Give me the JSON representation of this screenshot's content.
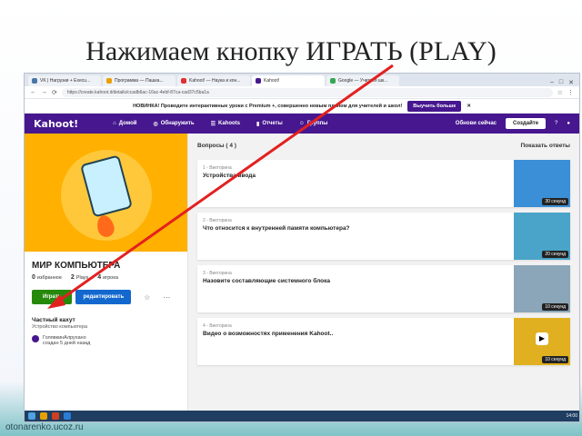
{
  "slide": {
    "title": "Нажимаем кнопку ИГРАТЬ (PLAY)",
    "watermark": "otonarenko.ucoz.ru"
  },
  "browser": {
    "tabs": [
      {
        "label": "VK | Нагрузки + Execu..."
      },
      {
        "label": "Программа — Пашка..."
      },
      {
        "label": "Kahoot! — Наука и кон..."
      },
      {
        "label": "Kahoot!"
      },
      {
        "label": "Google — Учиться шк..."
      }
    ],
    "url": "https://create.kahoot.it/details/ccadb6ac-16ac-4ebf-87ca-cad37c5ba1a",
    "promo_text": "НОВИНКА! Проводите интерактивные уроки с Premium +, совершенно новым планом для учителей и школ!",
    "promo_button": "Выучить больше",
    "promo_close": "✕"
  },
  "navbar": {
    "logo": "Kahoot!",
    "items": [
      "Домой",
      "Обнаружить",
      "Kahoots",
      "Отчеты",
      "Группы"
    ],
    "upgrade": "Обнови сейчас",
    "create": "Создайте"
  },
  "quiz": {
    "title": "МИР КОМПЬЮТЕРА",
    "stats": [
      {
        "num": "0",
        "label": "избранное"
      },
      {
        "num": "2",
        "label": "Plays"
      },
      {
        "num": "4",
        "label": "игрока"
      }
    ],
    "play_label": "Играть",
    "edit_label": "редактировать",
    "visibility": "Частный кахут",
    "description": "Устройство компьютера",
    "author_name": "ГолявкинАлрухано",
    "author_meta": "создан 5 дней назад"
  },
  "questions": {
    "header": "Вопросы  ( 4 )",
    "show_answers": "Показать ответы",
    "items": [
      {
        "type": "1 - Викторина",
        "title": "Устройства ввода",
        "time": "30 секунд",
        "color": "#3a8fd6"
      },
      {
        "type": "2 - Викторина",
        "title": "Что относится к внутренней памяти компьютера?",
        "time": "20 секунд",
        "color": "#4aa3c8"
      },
      {
        "type": "3 - Викторина",
        "title": "Назовите составляющие системного блока",
        "time": "10 секунд",
        "color": "#8aa6b8"
      },
      {
        "type": "4 - Викторина",
        "title": "Видео о возможностях применения Kahoot..",
        "time": "10 секунд",
        "color": "#e0b020"
      }
    ]
  },
  "taskbar": {
    "time": "14:00"
  },
  "colors": {
    "brand": "#46178f",
    "play": "#26890c",
    "edit": "#1368ce",
    "arrow": "#e32020"
  }
}
